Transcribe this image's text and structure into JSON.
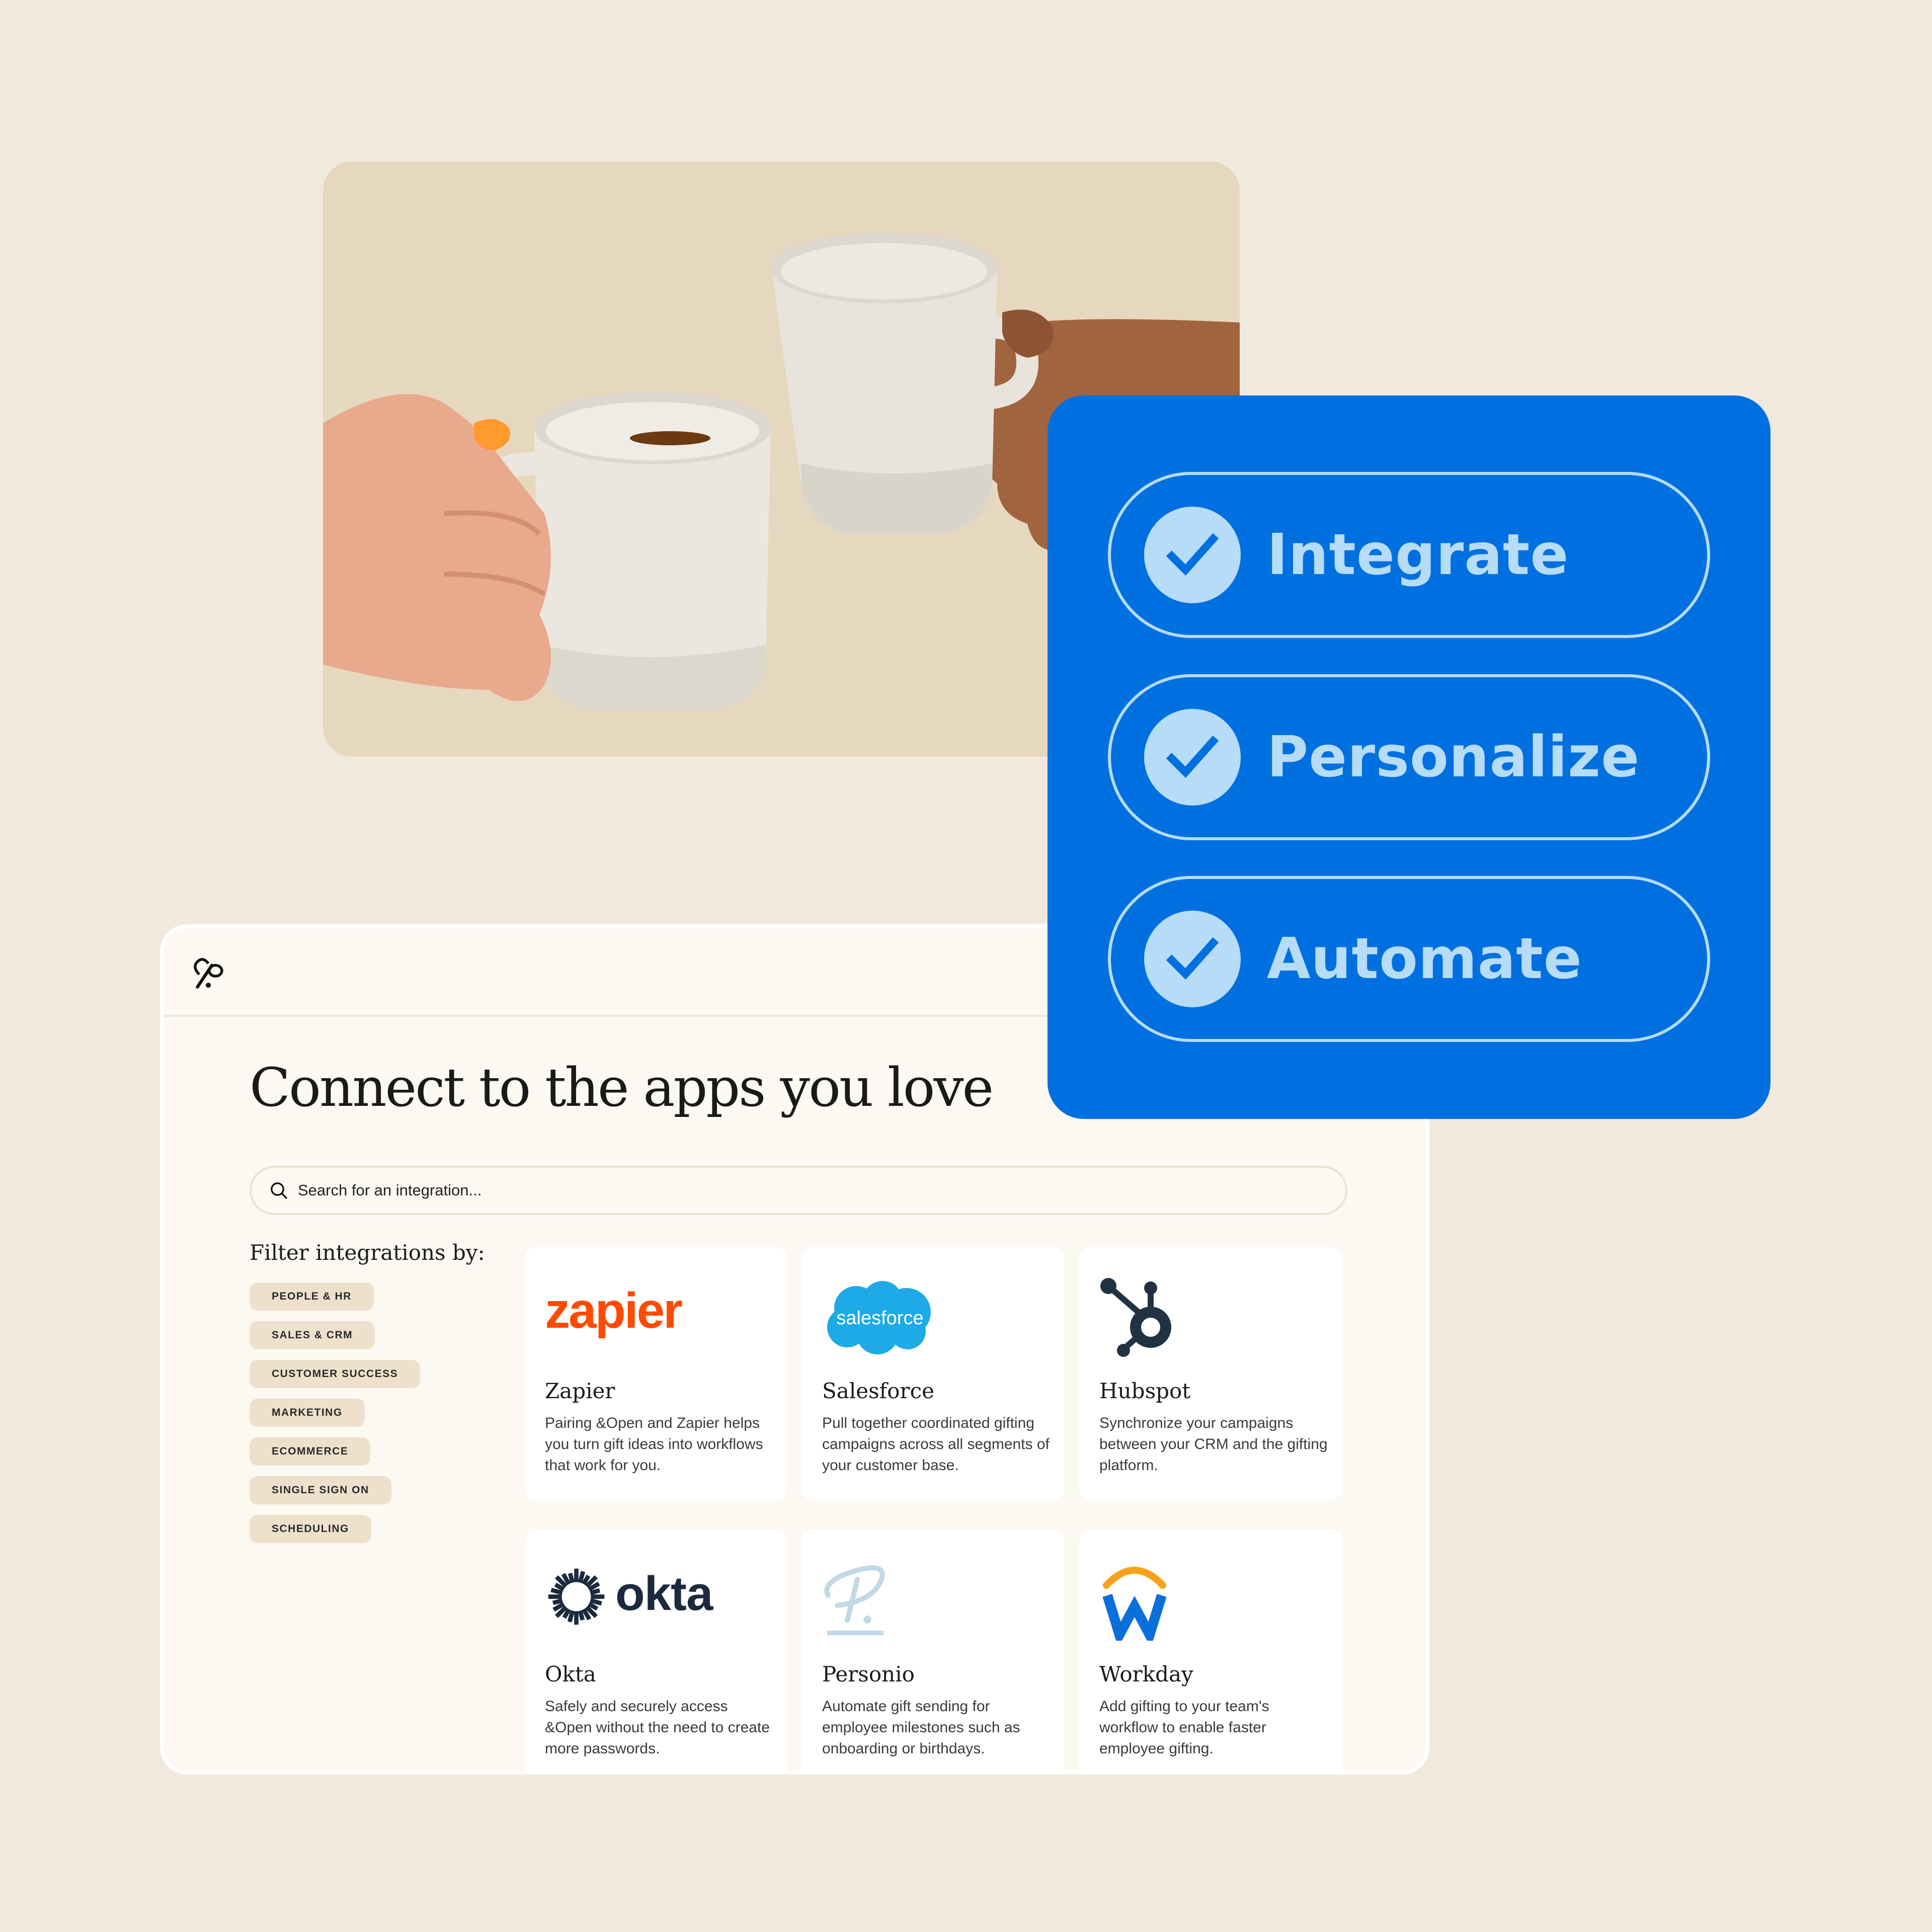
{
  "colors": {
    "page_background": "#f1e9de",
    "blue_card": "#0070e0",
    "pill_accent": "#b6dcf7",
    "chip_background": "#ede1cb",
    "window_background": "#fcf8f2",
    "zapier_orange": "#ff4a00",
    "salesforce_blue": "#1eaae7",
    "hubspot_navy": "#213343",
    "okta_navy": "#1b2a3c",
    "personio_light_blue": "#c2d8e6",
    "workday_blue": "#0b6fdb",
    "workday_orange": "#f9a11b"
  },
  "hero_photo": {
    "description": "Two hands clinking white ceramic mugs"
  },
  "features": [
    {
      "label": "Integrate",
      "icon": "check-circle-icon"
    },
    {
      "label": "Personalize",
      "icon": "check-circle-icon"
    },
    {
      "label": "Automate",
      "icon": "check-circle-icon"
    }
  ],
  "app": {
    "logo_icon": "and-open-logo-icon",
    "heading": "Connect to the apps you love",
    "search": {
      "icon": "search-icon",
      "placeholder": "Search for an integration...",
      "value": ""
    },
    "filter": {
      "label": "Filter integrations by:",
      "chips": [
        "PEOPLE & HR",
        "SALES & CRM",
        "CUSTOMER SUCCESS",
        "MARKETING",
        "ECOMMERCE",
        "SINGLE SIGN ON",
        "SCHEDULING"
      ]
    },
    "integrations": [
      {
        "name": "Zapier",
        "logo_text": "zapier",
        "logo_icon": "zapier-logo",
        "description": "Pairing &Open and Zapier helps you turn gift ideas into workflows that work for you."
      },
      {
        "name": "Salesforce",
        "logo_text": "salesforce",
        "logo_icon": "salesforce-cloud-logo",
        "description": "Pull together coordinated gifting campaigns across all segments of your customer base."
      },
      {
        "name": "Hubspot",
        "logo_icon": "hubspot-sprocket-logo",
        "description": "Synchronize your campaigns between your CRM and the gifting platform."
      },
      {
        "name": "Okta",
        "logo_text": "okta",
        "logo_icon": "okta-sunburst-logo",
        "description": "Safely and securely access &Open without the need to create more passwords."
      },
      {
        "name": "Personio",
        "logo_icon": "personio-p-logo",
        "description": "Automate gift sending for employee milestones such as onboarding or birthdays."
      },
      {
        "name": "Workday",
        "logo_icon": "workday-w-logo",
        "description": "Add gifting to your team's workflow to enable faster employee gifting."
      }
    ]
  }
}
